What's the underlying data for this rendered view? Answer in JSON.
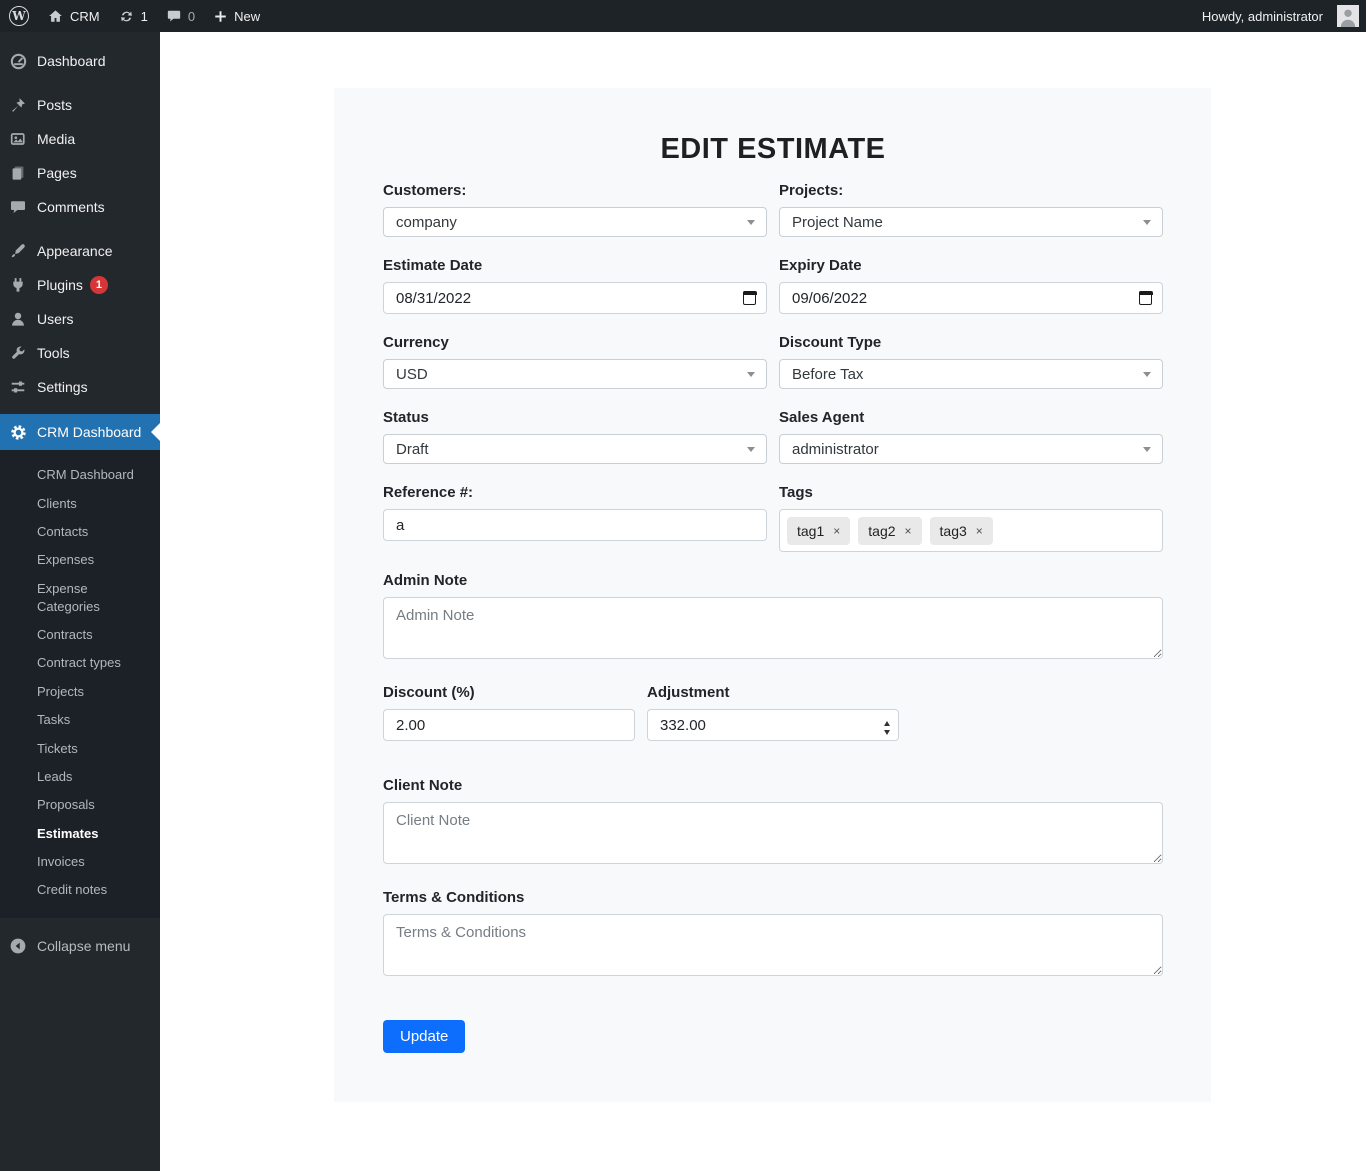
{
  "admin_bar": {
    "logo_letter": "W",
    "site_name": "CRM",
    "updates_count": "1",
    "comments_count": "0",
    "new_label": "New",
    "howdy_text": "Howdy, administrator"
  },
  "sidebar": {
    "items": [
      {
        "label": "Dashboard"
      },
      {
        "label": "Posts"
      },
      {
        "label": "Media"
      },
      {
        "label": "Pages"
      },
      {
        "label": "Comments"
      },
      {
        "label": "Appearance"
      },
      {
        "label": "Plugins",
        "badge": "1"
      },
      {
        "label": "Users"
      },
      {
        "label": "Tools"
      },
      {
        "label": "Settings"
      },
      {
        "label": "CRM Dashboard"
      }
    ],
    "submenu": [
      "CRM Dashboard",
      "Clients",
      "Contacts",
      "Expenses",
      "Expense Categories",
      "Contracts",
      "Contract types",
      "Projects",
      "Tasks",
      "Tickets",
      "Leads",
      "Proposals",
      "Estimates",
      "Invoices",
      "Credit notes"
    ],
    "active_submenu": "Estimates",
    "collapse_label": "Collapse menu"
  },
  "form": {
    "title": "EDIT ESTIMATE",
    "customers": {
      "label": "Customers:",
      "value": "company"
    },
    "projects": {
      "label": "Projects:",
      "value": "Project Name"
    },
    "estimate_date": {
      "label": "Estimate Date",
      "value": "08/31/2022"
    },
    "expiry_date": {
      "label": "Expiry Date",
      "value": "09/06/2022"
    },
    "currency": {
      "label": "Currency",
      "value": "USD"
    },
    "discount_type": {
      "label": "Discount Type",
      "value": "Before Tax"
    },
    "status": {
      "label": "Status",
      "value": "Draft"
    },
    "sales_agent": {
      "label": "Sales Agent",
      "value": "administrator"
    },
    "reference": {
      "label": "Reference #:",
      "value": "a"
    },
    "tags": {
      "label": "Tags",
      "items": [
        "tag1",
        "tag2",
        "tag3"
      ],
      "remove_glyph": "×"
    },
    "admin_note": {
      "label": "Admin Note",
      "placeholder": "Admin Note"
    },
    "discount": {
      "label": "Discount (%)",
      "value": "2.00"
    },
    "adjustment": {
      "label": "Adjustment",
      "value": "332.00"
    },
    "client_note": {
      "label": "Client Note",
      "placeholder": "Client Note"
    },
    "terms": {
      "label": "Terms & Conditions",
      "placeholder": "Terms & Conditions"
    },
    "update_label": "Update"
  },
  "colors": {
    "topbar_bg": "#1d2327",
    "sidebar_bg": "#23282d",
    "active_menu_bg": "#2271b1",
    "plugins_badge": "#d63638",
    "update_button": "#0d6efd",
    "card_bg": "#f8f9fa"
  }
}
